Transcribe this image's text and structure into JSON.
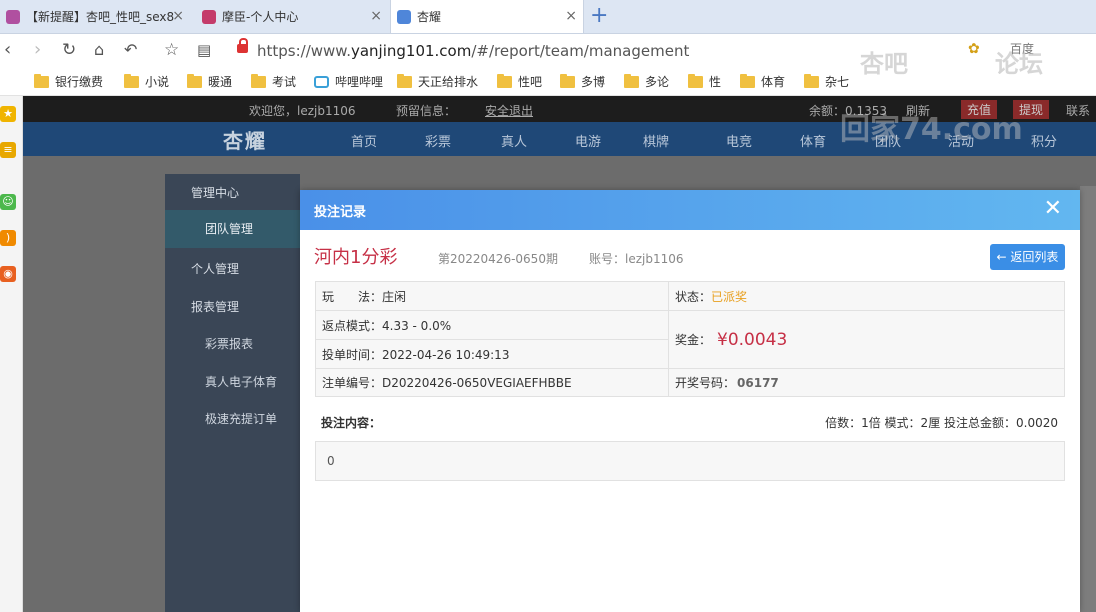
{
  "browser": {
    "tabs": [
      {
        "title": "【新提醒】杏吧_性吧_sex8",
        "active": false
      },
      {
        "title": "摩臣-个人中心",
        "active": false
      },
      {
        "title": "杏耀",
        "active": true
      }
    ],
    "url_scheme": "https://www.",
    "url_domain": "yanjing101.com",
    "url_path": "/#/report/team/management",
    "search_engine": "百度",
    "bookmarks": [
      "银行缴费",
      "小说",
      "暖通",
      "考试",
      "哔哩哔哩",
      "天正给排水",
      "性吧",
      "多博",
      "多论",
      "性",
      "体育",
      "杂七"
    ]
  },
  "site": {
    "welcome": "欢迎您，lezjb1106",
    "preview": "预留信息：",
    "logout": "安全退出",
    "balance": "余额：0.1353",
    "refresh": "刷新",
    "recharge": "充值",
    "withdraw": "提现",
    "contact": "联系",
    "logo": "杏耀",
    "nav": [
      "首页",
      "彩票",
      "真人",
      "电游",
      "棋牌",
      "电竞",
      "体育",
      "团队",
      "活动",
      "积分"
    ]
  },
  "sidemenu": {
    "items": [
      {
        "label": "管理中心",
        "head": true
      },
      {
        "label": "团队管理",
        "selected": true
      },
      {
        "label": "个人管理",
        "head": true
      },
      {
        "label": "报表管理",
        "head": true
      },
      {
        "label": "彩票报表"
      },
      {
        "label": "真人电子体育"
      },
      {
        "label": "极速充提订单"
      }
    ]
  },
  "modal": {
    "title": "投注记录",
    "game": "河内1分彩",
    "period": "第20220426-0650期",
    "account": "账号：lezjb1106",
    "back_button": "返回列表",
    "play_label": "玩　　法：",
    "play_value": "庄闲",
    "status_label": "状态：",
    "status_value": "已派奖",
    "rebate": "返点模式：4.33 - 0.0%",
    "time": "投单时间：2022-04-26 10:49:13",
    "prize_label": "奖金：",
    "prize_value": "¥0.0043",
    "order_no": "注单编号：D20220426-0650VEGIAEFHBBE",
    "draw_label": "开奖号码：",
    "draw_value": "06177",
    "bet_label": "投注内容：",
    "bet_meta": "倍数：1倍  模式：2厘  投注总金额：0.0020",
    "bet_content": "0"
  },
  "watermark": {
    "line1": "杏吧",
    "line2": "论坛",
    "line3": "回家74.com"
  },
  "colors": {
    "header_start": "#4a90e8",
    "header_end": "#62b7f0",
    "accent_red": "#c63046",
    "status_orange": "#e8a020",
    "button_blue": "#3a8ee6"
  }
}
